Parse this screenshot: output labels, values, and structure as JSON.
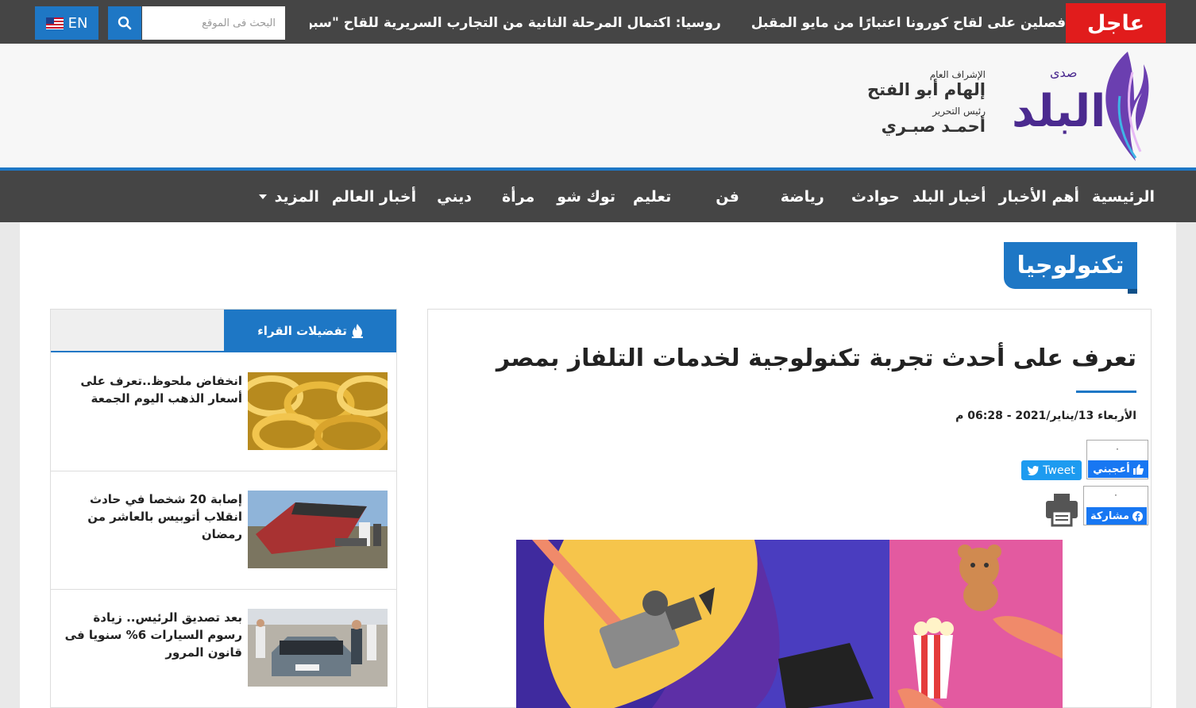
{
  "topbar": {
    "urgent_label": "عاجل",
    "ticker": [
      "فصلين على لقاح كورونا اعتبارًا من مايو المقبل",
      "روسيا: اكتمال المرحلة الثانية من التجارب السريرية للقاح \"سبوتنيك لايت\""
    ],
    "search_placeholder": "البحث فى الموقع",
    "lang_label": "EN"
  },
  "header": {
    "logo_small": "صدى",
    "logo_big": "البلد",
    "credits": [
      {
        "role": "الإشراف العام",
        "name": "إلهام أبو الفتح"
      },
      {
        "role": "رئيس التحرير",
        "name": "أحمـد صبـري"
      }
    ]
  },
  "nav": {
    "items": [
      "الرئيسية",
      "أهم الأخبار",
      "أخبار البلد",
      "حوادث",
      "رياضة",
      "فن",
      "تعليم",
      "توك شو",
      "مرأة",
      "ديني",
      "أخبار العالم"
    ],
    "more_label": "المزيد"
  },
  "section": {
    "label": "تكنولوجيا"
  },
  "article": {
    "headline": "تعرف على أحدث تجربة تكنولوجية لخدمات التلفاز بمصر",
    "date": "الأربعاء 13/يناير/2021 - 06:28 م",
    "like_count": "٠",
    "like_label": "أعجبني",
    "tweet_label": "Tweet",
    "share_count": "٠",
    "share_label": "مشاركة"
  },
  "sidebar": {
    "tab_label": "تفضيلات القراء",
    "items": [
      {
        "title": "انخفاض ملحوظ..تعرف على أسعار الذهب اليوم الجمعة"
      },
      {
        "title": "إصابة 20 شخصا في حادث انقلاب أتوبيس بالعاشر من رمضان"
      },
      {
        "title": "بعد تصديق الرئيس.. زيادة رسوم السيارات 6% سنويا فى قانون المرور"
      }
    ]
  },
  "colors": {
    "accent": "#1e77c5",
    "urgent": "#e11c1c",
    "dark_bar": "#454545",
    "logo_purple": "#4b2a8f"
  }
}
